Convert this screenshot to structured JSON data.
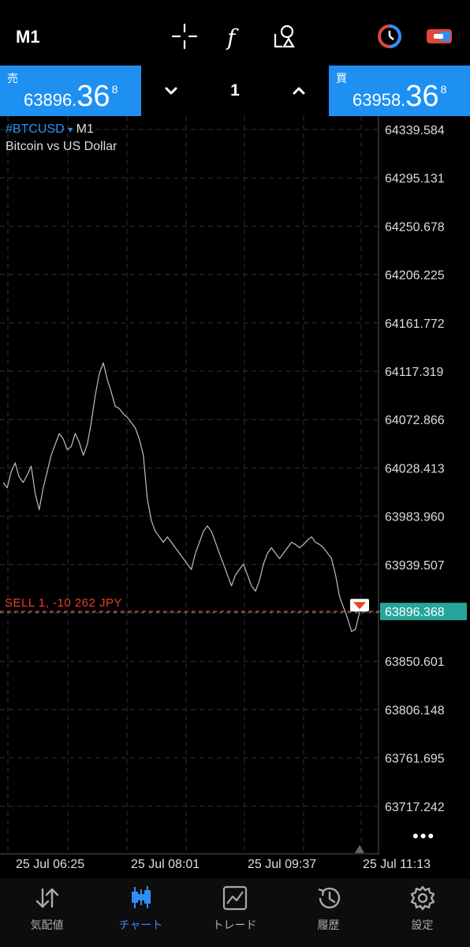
{
  "toolbar": {
    "timeframe": "M1",
    "icons": [
      "crosshair-icon",
      "indicators-f-icon",
      "objects-icon",
      "one-click-trading-icon",
      "account-icon"
    ]
  },
  "quotes": {
    "sell_label": "売",
    "sell_price_small": "63896.",
    "sell_price_big": "36",
    "sell_price_sup": "8",
    "buy_label": "買",
    "buy_price_small": "63958.",
    "buy_price_big": "36",
    "buy_price_sup": "8",
    "lot": "1",
    "accent": "#1e90f2"
  },
  "chart_header": {
    "symbol": "#BTCUSD",
    "arrow": "▾",
    "timeframe": "M1",
    "description": "Bitcoin vs US Dollar"
  },
  "position_line": {
    "label": "SELL 1, -10 262 JPY",
    "color": "#e8402a"
  },
  "current_price": {
    "label": "63896.368",
    "color": "#26a69a"
  },
  "more_label": "•••",
  "chart_data": {
    "type": "line",
    "title": "",
    "xlabel": "",
    "ylabel": "",
    "ylim": [
      63717.242,
      64339.584
    ],
    "y_ticks": [
      "64339.584",
      "64295.131",
      "64250.678",
      "64206.225",
      "64161.772",
      "64117.319",
      "64072.866",
      "64028.413",
      "63983.960",
      "63939.507",
      "63896.368",
      "63850.601",
      "63806.148",
      "63761.695",
      "63717.242"
    ],
    "x_ticks": [
      "25 Jul 06:25",
      "25 Jul 08:01",
      "25 Jul 09:37",
      "25 Jul 11:13"
    ],
    "grid": true,
    "series": [
      {
        "values": [
          64015,
          64010,
          64025,
          64033,
          64020,
          64015,
          64022,
          64030,
          64005,
          63990,
          64010,
          64025,
          64040,
          64050,
          64060,
          64055,
          64045,
          64048,
          64060,
          64052,
          64040,
          64050,
          64070,
          64095,
          64115,
          64125,
          64110,
          64098,
          64085,
          64083,
          64078,
          64075,
          64070,
          64065,
          64055,
          64040,
          64000,
          63980,
          63970,
          63965,
          63960,
          63965,
          63960,
          63955,
          63950,
          63945,
          63940,
          63935,
          63950,
          63960,
          63970,
          63975,
          63970,
          63960,
          63950,
          63940,
          63930,
          63920,
          63930,
          63935,
          63940,
          63930,
          63920,
          63915,
          63925,
          63940,
          63950,
          63955,
          63950,
          63945,
          63950,
          63955,
          63960,
          63958,
          63955,
          63958,
          63962,
          63965,
          63960,
          63958,
          63955,
          63950,
          63945,
          63930,
          63910,
          63900,
          63890,
          63878,
          63880,
          63896
        ]
      }
    ]
  },
  "bottom_nav": [
    {
      "label": "気配値",
      "icon": "quotes-icon"
    },
    {
      "label": "チャート",
      "icon": "chart-candles-icon"
    },
    {
      "label": "トレード",
      "icon": "trade-icon"
    },
    {
      "label": "履歴",
      "icon": "history-icon"
    },
    {
      "label": "設定",
      "icon": "settings-gear-icon"
    }
  ],
  "colors": {
    "background": "#000000",
    "grid": "#2a3440",
    "axis_text": "#dddddd",
    "price_line": "#c0c0c0",
    "accent": "#2f8df5"
  }
}
